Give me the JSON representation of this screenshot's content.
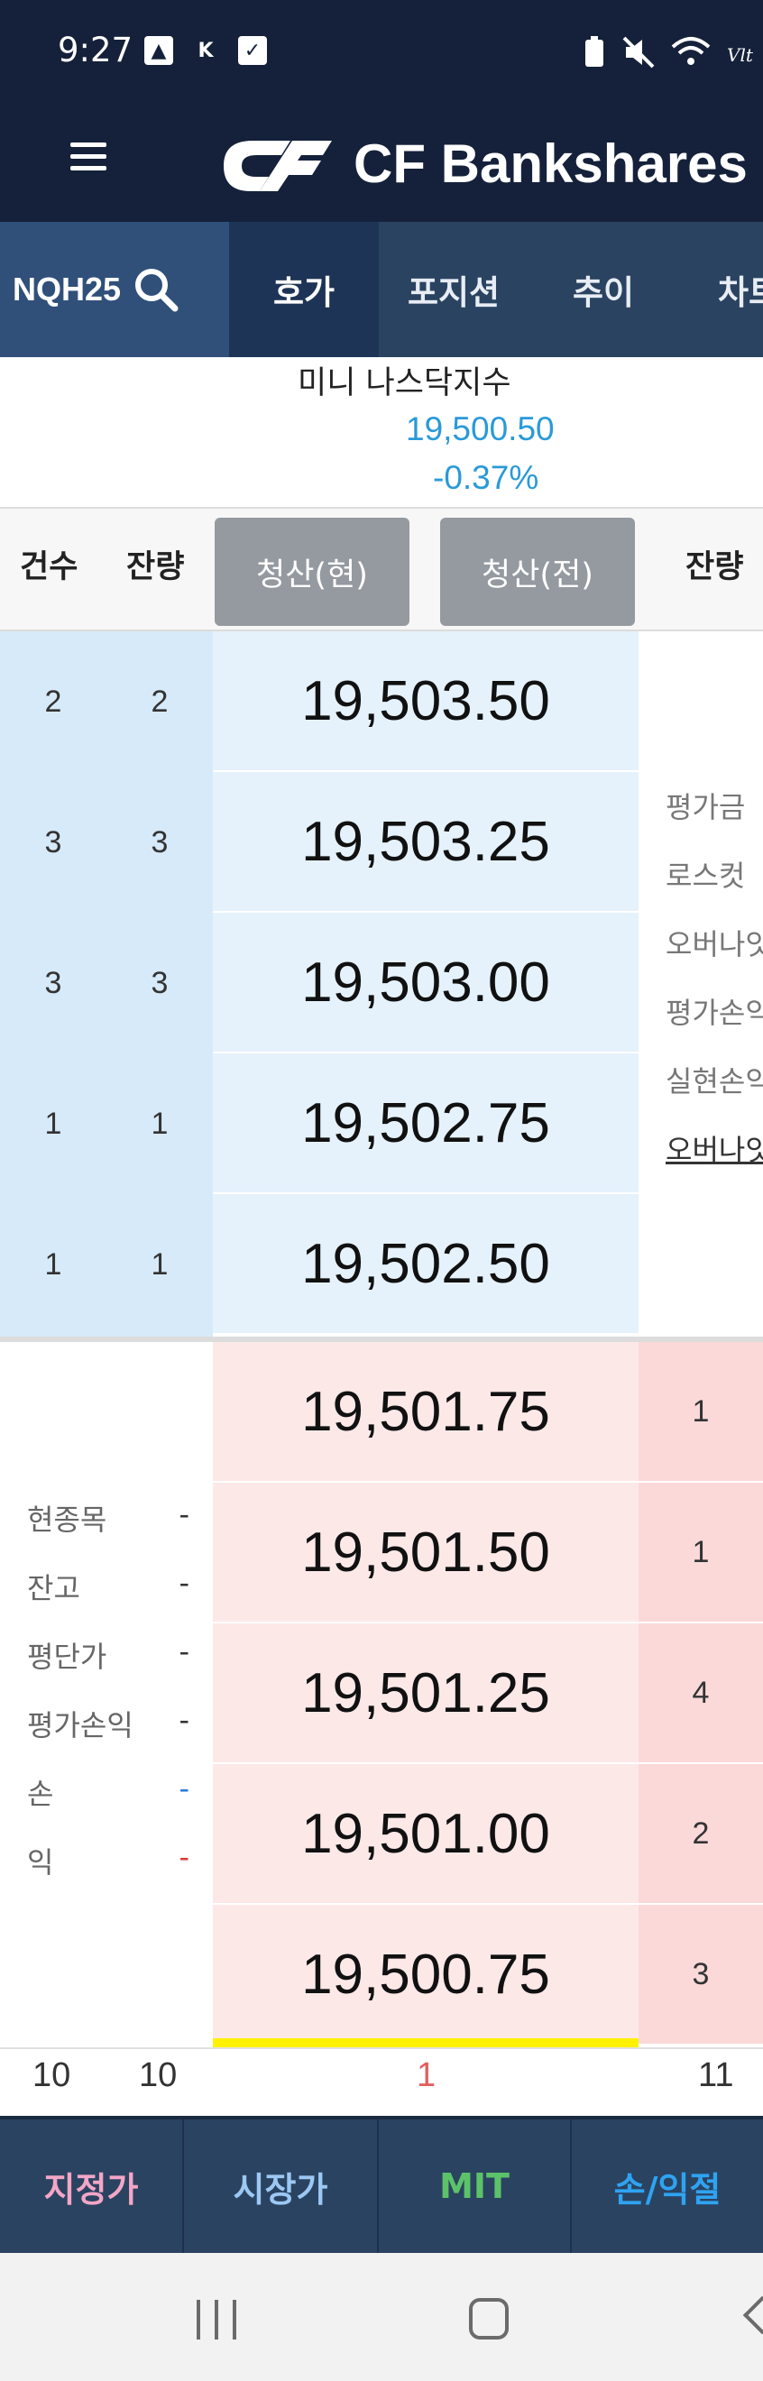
{
  "status_bar": {
    "time": "9:27"
  },
  "header": {
    "brand": "CF Bankshares"
  },
  "tabs": {
    "symbol": "NQH25",
    "items": [
      "호가",
      "포지션",
      "추이",
      "차트"
    ]
  },
  "instrument": {
    "name": "미니 나스닥지수",
    "price": "19,500.50",
    "change": "-0.37%"
  },
  "columns": {
    "count": "건수",
    "qty": "잔량",
    "clear_current": "청산(현)",
    "clear_all": "청산(전)",
    "qty_right": "잔량"
  },
  "sell_orders": [
    {
      "count": "2",
      "qty": "2",
      "price": "19,503.50"
    },
    {
      "count": "3",
      "qty": "3",
      "price": "19,503.25"
    },
    {
      "count": "3",
      "qty": "3",
      "price": "19,503.00"
    },
    {
      "count": "1",
      "qty": "1",
      "price": "19,502.75"
    },
    {
      "count": "1",
      "qty": "1",
      "price": "19,502.50"
    }
  ],
  "right_panel": {
    "items": [
      "평가금",
      "로스컷",
      "오버나잇",
      "평가손익",
      "실현손익"
    ],
    "link": "오버나잇"
  },
  "buy_orders": [
    {
      "price": "19,501.75",
      "qty": "1"
    },
    {
      "price": "19,501.50",
      "qty": "1"
    },
    {
      "price": "19,501.25",
      "qty": "4"
    },
    {
      "price": "19,501.00",
      "qty": "2"
    },
    {
      "price": "19,500.75",
      "qty": "3"
    }
  ],
  "position": {
    "rows": [
      {
        "label": "현종목",
        "value": "-"
      },
      {
        "label": "잔고",
        "value": "-"
      },
      {
        "label": "평단가",
        "value": "-"
      },
      {
        "label": "평가손익",
        "value": "-"
      },
      {
        "label": "손",
        "value": "-"
      },
      {
        "label": "익",
        "value": "-"
      }
    ]
  },
  "totals": {
    "sell_count": "10",
    "sell_qty": "10",
    "diff": "1",
    "buy_qty": "11"
  },
  "order_buttons": {
    "limit": "지정가",
    "market": "시장가",
    "mit": "MIT",
    "stop": "손/익절"
  },
  "colors": {
    "header_bg": "#15213a",
    "tab_bg": "#2a4361",
    "sell_bg": "#e5f2fc",
    "buy_bg": "#fde8e8",
    "accent_blue": "#2a9ad8",
    "current_marker": "#fff200"
  }
}
